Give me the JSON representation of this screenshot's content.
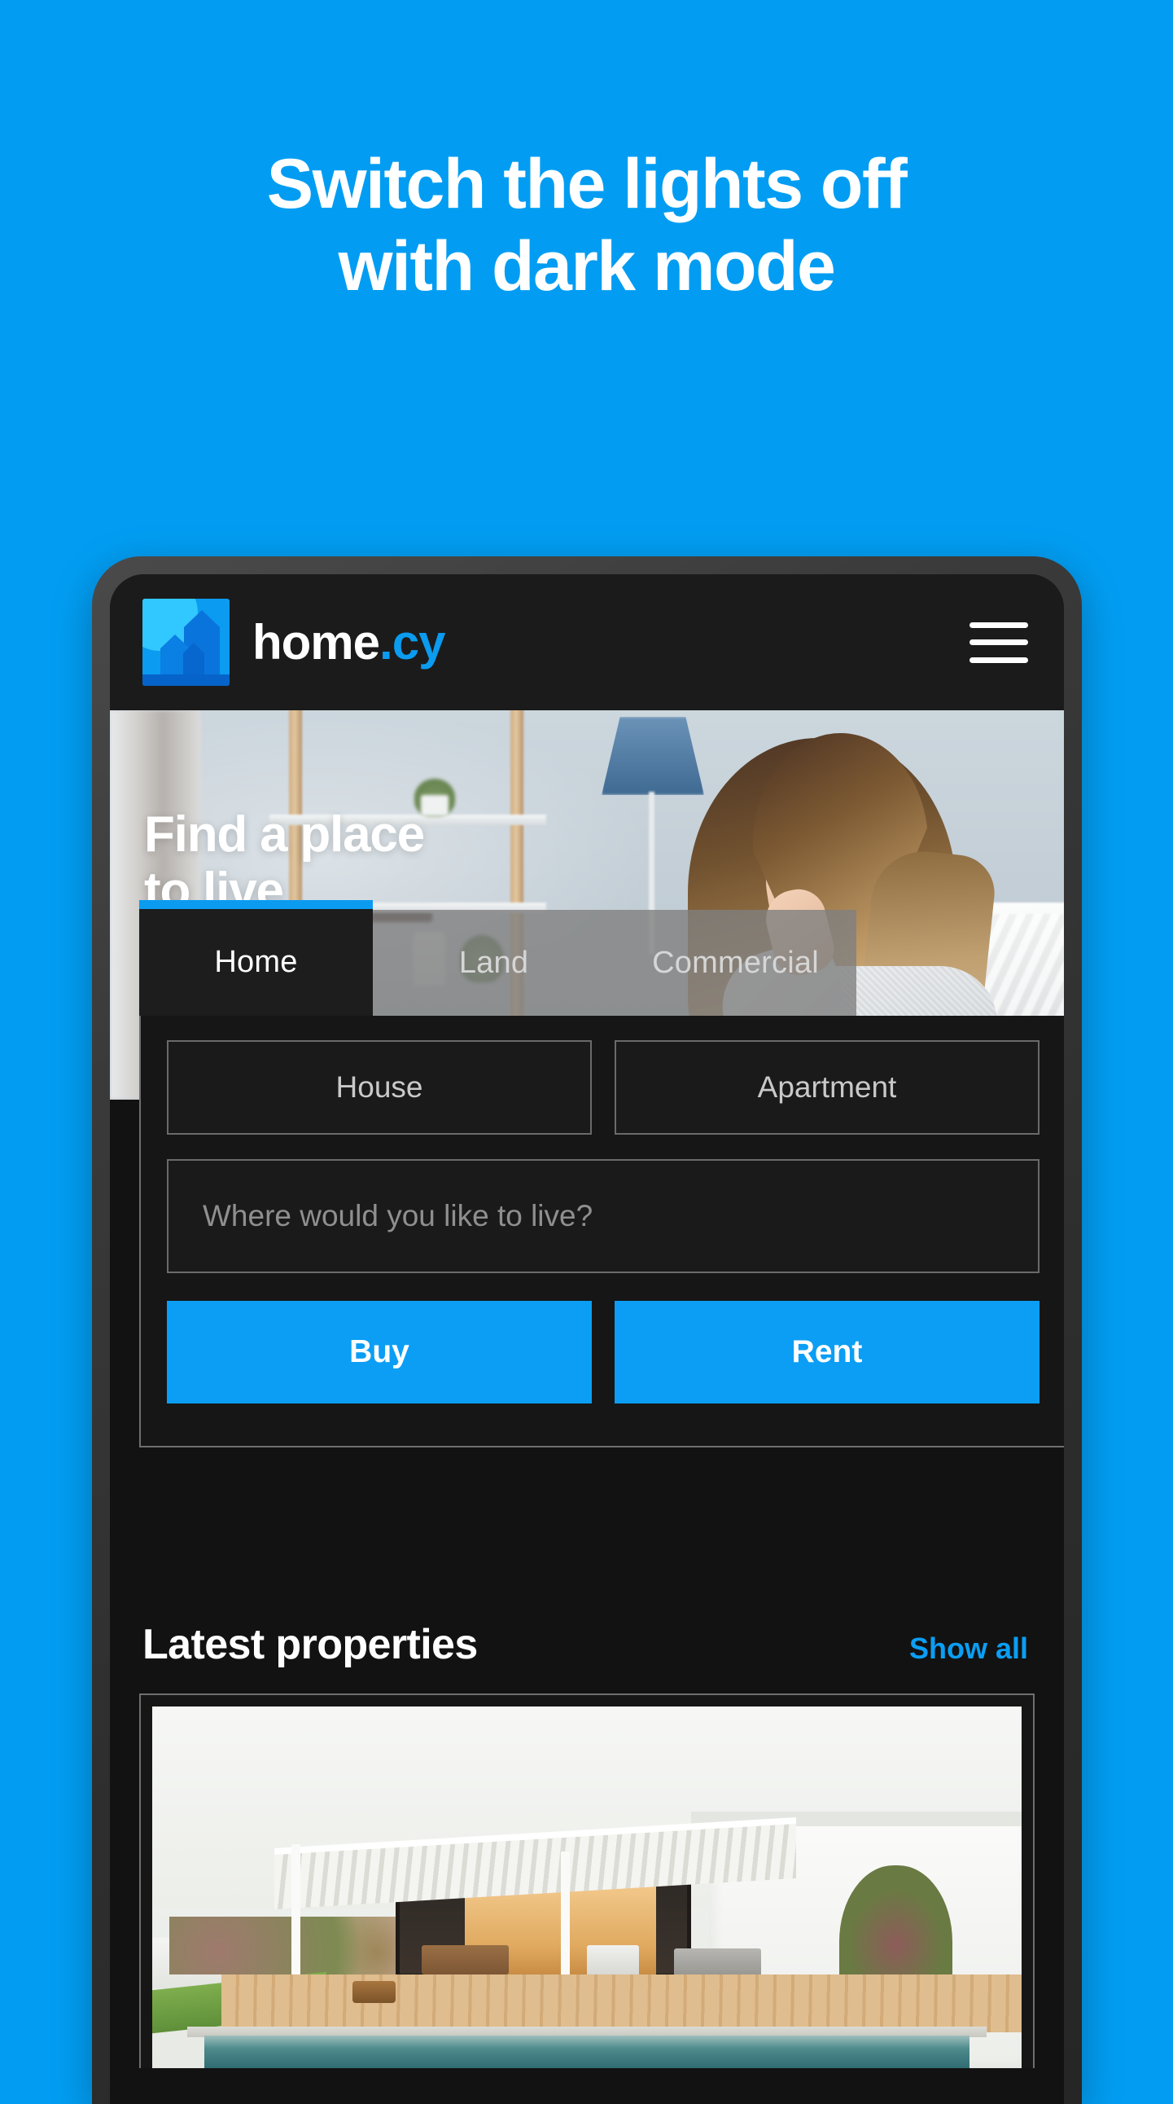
{
  "promo": {
    "headline_line1": "Switch the lights off",
    "headline_line2": "with dark mode",
    "background_color": "#029DF2"
  },
  "app": {
    "accent_color": "#0B9EF4",
    "surface_color": "#121212",
    "header": {
      "logo_icon": "home-building-logo-icon",
      "brand_name": "home",
      "brand_tld": ".cy",
      "menu_icon": "hamburger-menu-icon"
    },
    "hero": {
      "title_line1": "Find a place",
      "title_line2": "to live",
      "photo_alt": "smiling-woman-in-bright-living-room"
    },
    "search": {
      "tabs": [
        {
          "label": "Home",
          "active": true
        },
        {
          "label": "Land",
          "active": false
        },
        {
          "label": "Commercial",
          "active": false
        }
      ],
      "property_types": [
        {
          "label": "House"
        },
        {
          "label": "Apartment"
        }
      ],
      "location": {
        "value": "",
        "placeholder": "Where would you like to live?"
      },
      "actions": [
        {
          "label": "Buy"
        },
        {
          "label": "Rent"
        }
      ]
    },
    "latest": {
      "title": "Latest properties",
      "show_all_label": "Show all",
      "cards": [
        {
          "photo_alt": "modern-white-villa-with-pool-and-wooden-deck"
        }
      ]
    }
  }
}
